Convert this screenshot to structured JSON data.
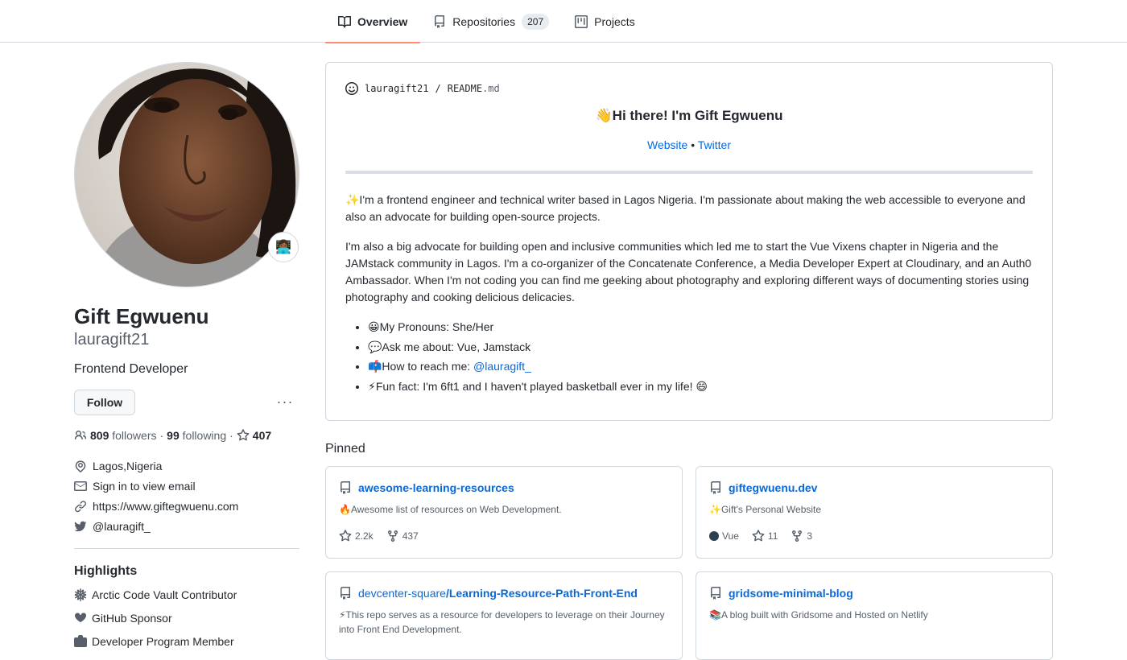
{
  "nav": {
    "tabs": [
      {
        "label": "Overview",
        "icon": "book-icon",
        "active": true
      },
      {
        "label": "Repositories",
        "icon": "repo-icon",
        "count": "207"
      },
      {
        "label": "Projects",
        "icon": "project-icon"
      }
    ]
  },
  "profile": {
    "full_name": "Gift Egwuenu",
    "username": "lauragift21",
    "bio": "Frontend Developer",
    "status_emoji": "👩🏾‍💻",
    "follow_label": "Follow",
    "more_label": "···",
    "followers_count": "809",
    "followers_label": "followers",
    "following_count": "99",
    "following_label": "following",
    "stars_count": "407",
    "location": "Lagos,Nigeria",
    "email": "Sign in to view email",
    "website": "https://www.giftegwuenu.com",
    "twitter": "@lauragift_",
    "highlights_title": "Highlights",
    "highlights": [
      "Arctic Code Vault Contributor",
      "GitHub Sponsor",
      "Developer Program Member"
    ]
  },
  "readme": {
    "owner": "lauragift21",
    "sep": "/",
    "file": "README",
    "ext": ".md",
    "greeting": "👋Hi there! I'm Gift Egwuenu",
    "link_website": "Website",
    "link_sep": "•",
    "link_twitter": "Twitter",
    "para1": "✨I'm a frontend engineer and technical writer based in Lagos Nigeria. I'm passionate about making the web accessible to everyone and also an advocate for building open-source projects.",
    "para2": "I'm also a big advocate for building open and inclusive communities which led me to start the Vue Vixens chapter in Nigeria and the JAMstack community in Lagos. I'm a co-organizer of the Concatenate Conference, a Media Developer Expert at Cloudinary, and an Auth0 Ambassador. When I'm not coding you can find me geeking about photography and exploring different ways of documenting stories using photography and cooking delicious delicacies.",
    "bullets": {
      "b1": "😀My Pronouns: She/Her",
      "b2": "💬Ask me about: Vue, Jamstack",
      "b3_text": "📫How to reach me: ",
      "b3_link": "@lauragift_",
      "b4": "⚡Fun fact: I'm 6ft1 and I haven't played basketball ever in my life! 😄"
    }
  },
  "pinned": {
    "title": "Pinned",
    "repos": [
      {
        "owner": "",
        "name": "awesome-learning-resources",
        "desc": "🔥Awesome list of resources on Web Development.",
        "lang": "",
        "stars": "2.2k",
        "forks": "437"
      },
      {
        "owner": "",
        "name": "giftegwuenu.dev",
        "desc": "✨Gift's Personal Website",
        "lang": "Vue",
        "lang_color": "#2c3e50",
        "stars": "11",
        "forks": "3"
      },
      {
        "owner": "devcenter-square",
        "name": "Learning-Resource-Path-Front-End",
        "desc": "⚡This repo serves as a resource for developers to leverage on their Journey into Front End Development."
      },
      {
        "owner": "",
        "name": "gridsome-minimal-blog",
        "desc": "📚A blog built with Gridsome and Hosted on Netlify"
      }
    ]
  }
}
